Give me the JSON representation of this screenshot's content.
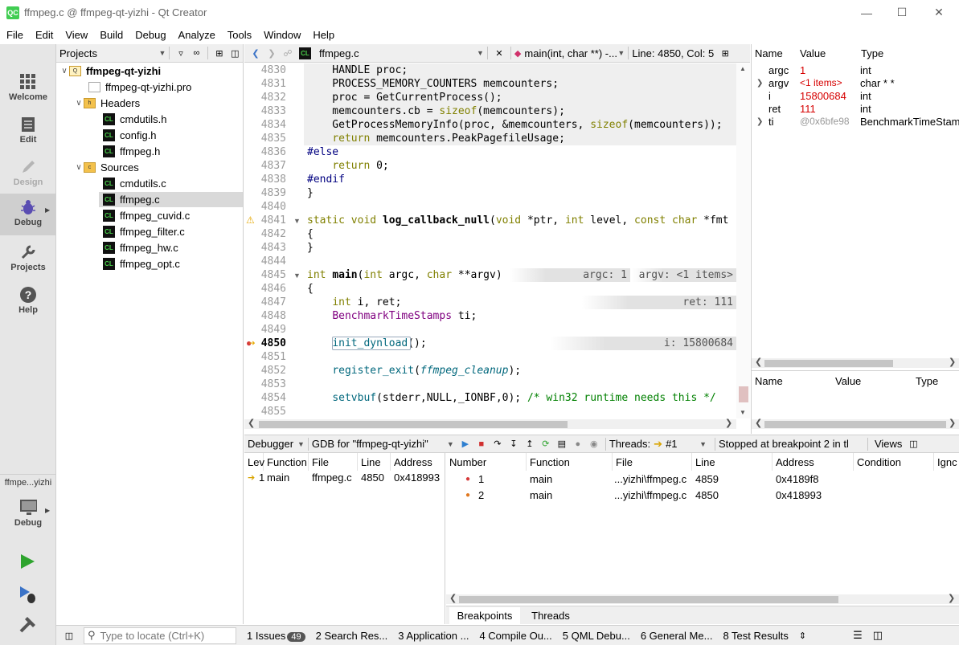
{
  "window": {
    "title": "ffmpeg.c @ ffmpeg-qt-yizhi - Qt Creator",
    "logo": "QC"
  },
  "menu": [
    "File",
    "Edit",
    "View",
    "Build",
    "Debug",
    "Analyze",
    "Tools",
    "Window",
    "Help"
  ],
  "modes": [
    {
      "label": "Welcome",
      "icon": "grid-icon"
    },
    {
      "label": "Edit",
      "icon": "document-icon"
    },
    {
      "label": "Design",
      "icon": "pencil-icon"
    },
    {
      "label": "Debug",
      "icon": "bug-icon"
    },
    {
      "label": "Projects",
      "icon": "wrench-icon"
    },
    {
      "label": "Help",
      "icon": "question-icon"
    }
  ],
  "kit": {
    "name": "ffmpe...yizhi",
    "mode": "Debug"
  },
  "projects": {
    "selector": "Projects",
    "root": "ffmpeg-qt-yizhi",
    "pro_file": "ffmpeg-qt-yizhi.pro",
    "headers_label": "Headers",
    "headers": [
      "cmdutils.h",
      "config.h",
      "ffmpeg.h"
    ],
    "sources_label": "Sources",
    "sources": [
      "cmdutils.c",
      "ffmpeg.c",
      "ffmpeg_cuvid.c",
      "ffmpeg_filter.c",
      "ffmpeg_hw.c",
      "ffmpeg_opt.c"
    ]
  },
  "editor": {
    "file": "ffmpeg.c",
    "symbol": "main(int, char **) -...",
    "position": "Line: 4850, Col: 5",
    "lines": [
      {
        "n": "4830",
        "t": "    HANDLE proc;"
      },
      {
        "n": "4831",
        "t": "    PROCESS_MEMORY_COUNTERS memcounters;"
      },
      {
        "n": "4832",
        "t": "    proc = GetCurrentProcess();"
      },
      {
        "n": "4833",
        "t": "    memcounters.cb = sizeof(memcounters);"
      },
      {
        "n": "4834",
        "t": "    GetProcessMemoryInfo(proc, &memcounters, sizeof(memcounters));"
      },
      {
        "n": "4835",
        "t": "    return memcounters.PeakPagefileUsage;"
      },
      {
        "n": "4836",
        "t": "#else"
      },
      {
        "n": "4837",
        "t": "    return 0;"
      },
      {
        "n": "4838",
        "t": "#endif"
      },
      {
        "n": "4839",
        "t": "}"
      },
      {
        "n": "4840",
        "t": ""
      },
      {
        "n": "4841",
        "t": "static void log_callback_null(void *ptr, int level, const char *fmt"
      },
      {
        "n": "4842",
        "t": "{"
      },
      {
        "n": "4843",
        "t": "}"
      },
      {
        "n": "4844",
        "t": ""
      },
      {
        "n": "4845",
        "t": "int main(int argc, char **argv)"
      },
      {
        "n": "4846",
        "t": "{"
      },
      {
        "n": "4847",
        "t": "    int i, ret;"
      },
      {
        "n": "4848",
        "t": "    BenchmarkTimeStamps ti;"
      },
      {
        "n": "4849",
        "t": ""
      },
      {
        "n": "4850",
        "t": "    init_dynload();"
      },
      {
        "n": "4851",
        "t": ""
      },
      {
        "n": "4852",
        "t": "    register_exit(ffmpeg_cleanup);"
      },
      {
        "n": "4853",
        "t": ""
      },
      {
        "n": "4854",
        "t": "    setvbuf(stderr,NULL,_IONBF,0); /* win32 runtime needs this */"
      },
      {
        "n": "4855",
        "t": ""
      }
    ],
    "hints": {
      "argc": "argc: 1",
      "argv": "argv: <1 items>",
      "ret": "ret: 111",
      "i": "i: 15800684"
    }
  },
  "locals": {
    "columns": [
      "Name",
      "Value",
      "Type"
    ],
    "rows": [
      {
        "name": "argc",
        "value": "1",
        "type": "int",
        "expand": false,
        "valcolor": "red"
      },
      {
        "name": "argv",
        "value": "<1 items>",
        "type": "char * *",
        "expand": true,
        "valcolor": "red"
      },
      {
        "name": "i",
        "value": "15800684",
        "type": "int",
        "expand": false,
        "valcolor": "red"
      },
      {
        "name": "ret",
        "value": "111",
        "type": "int",
        "expand": false,
        "valcolor": "red"
      },
      {
        "name": "ti",
        "value": "@0x6bfe98",
        "type": "BenchmarkTimeStam",
        "expand": true,
        "valcolor": "gray"
      }
    ],
    "watch_columns": [
      "Name",
      "Value",
      "Type"
    ]
  },
  "debugger": {
    "label": "Debugger",
    "engine": "GDB for \"ffmpeg-qt-yizhi\"",
    "threads_label": "Threads:",
    "thread": "#1",
    "status": "Stopped at breakpoint 2 in tl",
    "views": "Views"
  },
  "stack": {
    "columns": [
      "Lev",
      "Function",
      "File",
      "Line",
      "Address"
    ],
    "rows": [
      {
        "lev": "1",
        "function": "main",
        "file": "ffmpeg.c",
        "line": "4850",
        "address": "0x418993"
      }
    ]
  },
  "breakpoints": {
    "columns": [
      "Number",
      "Function",
      "File",
      "Line",
      "Address",
      "Condition",
      "Ignc"
    ],
    "rows": [
      {
        "number": "1",
        "function": "main",
        "file": "...yizhi\\ffmpeg.c",
        "line": "4859",
        "address": "0x4189f8"
      },
      {
        "number": "2",
        "function": "main",
        "file": "...yizhi\\ffmpeg.c",
        "line": "4850",
        "address": "0x418993"
      }
    ],
    "tabs": [
      "Breakpoints",
      "Threads"
    ]
  },
  "statusbar": {
    "locate_placeholder": "Type to locate (Ctrl+K)",
    "panes": [
      "1  Issues",
      "2  Search Res...",
      "3  Application ...",
      "4  Compile Ou...",
      "5  QML Debu...",
      "6  General Me...",
      "8  Test Results"
    ],
    "issues_count": "49"
  }
}
